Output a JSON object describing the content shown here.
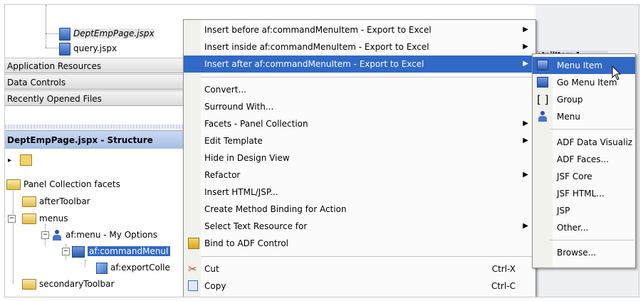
{
  "navigator": {
    "files": [
      {
        "name": "DeptEmpPage.jspx",
        "selected": true
      },
      {
        "name": "query.jspx",
        "selected": false
      }
    ],
    "sections": [
      "Application Resources",
      "Data Controls",
      "Recently Opened Files"
    ],
    "structure_title": "DeptEmpPage.jspx - Structure",
    "tree": [
      {
        "label": "Panel Collection facets",
        "icon": "folder-icon",
        "depth": 0
      },
      {
        "label": "afterToolbar",
        "icon": "folder-icon",
        "depth": 1
      },
      {
        "label": "menus",
        "icon": "folder-icon",
        "depth": 1,
        "expander": "−"
      },
      {
        "label": "af:menu - My Options",
        "icon": "menu-component-icon",
        "depth": 2,
        "expander": "−"
      },
      {
        "label": "af:commandMenuI",
        "icon": "command-menu-item-icon",
        "depth": 3,
        "expander": "−",
        "selected": true
      },
      {
        "label": "af:exportColle",
        "icon": "export-collection-icon",
        "depth": 4
      },
      {
        "label": "secondaryToolbar",
        "icon": "folder-icon",
        "depth": 1
      }
    ]
  },
  "background_tab": {
    "label": "etailItem 1"
  },
  "context_menu": {
    "items": [
      {
        "label": "Insert before af:commandMenuItem - Export to Excel",
        "submenu": true
      },
      {
        "label": "Insert inside af:commandMenuItem - Export to Excel",
        "submenu": true
      },
      {
        "label": "Insert after af:commandMenuItem - Export to Excel",
        "submenu": true,
        "highlighted": true
      },
      {
        "separator": true
      },
      {
        "label": "Convert..."
      },
      {
        "label": "Surround With..."
      },
      {
        "label": "Facets - Panel Collection",
        "submenu": true
      },
      {
        "label": "Edit Template",
        "submenu": true
      },
      {
        "label": "Hide in Design View"
      },
      {
        "label": "Refactor",
        "submenu": true
      },
      {
        "label": "Insert HTML/JSP..."
      },
      {
        "label": "Create Method Binding for Action"
      },
      {
        "label": "Select Text Resource for",
        "submenu": true
      },
      {
        "label": "Bind to ADF Control",
        "icon": "bind-adf-icon"
      },
      {
        "separator": true
      },
      {
        "label": "Cut",
        "accelerator": "Ctrl-X",
        "icon": "scissors-icon"
      },
      {
        "label": "Copy",
        "accelerator": "Ctrl-C",
        "icon": "copy-icon"
      }
    ]
  },
  "submenu": {
    "items": [
      {
        "label": "Menu Item",
        "icon": "menu-item-icon",
        "highlighted": true
      },
      {
        "label": "Go Menu Item",
        "icon": "go-menu-item-icon"
      },
      {
        "label": "Group",
        "icon": "group-bracket-icon"
      },
      {
        "label": "Menu",
        "icon": "menu-component-icon"
      },
      {
        "separator": true
      },
      {
        "label": "ADF Data Visualiz"
      },
      {
        "label": "ADF Faces..."
      },
      {
        "label": "JSF Core"
      },
      {
        "label": "JSF HTML..."
      },
      {
        "label": "JSP"
      },
      {
        "label": "Other..."
      },
      {
        "separator": true
      },
      {
        "label": "Browse..."
      }
    ]
  },
  "colors": {
    "highlight": "#3169c6",
    "menu_bg": "#fbfbfb",
    "header_bg": "#dcdcdc"
  }
}
